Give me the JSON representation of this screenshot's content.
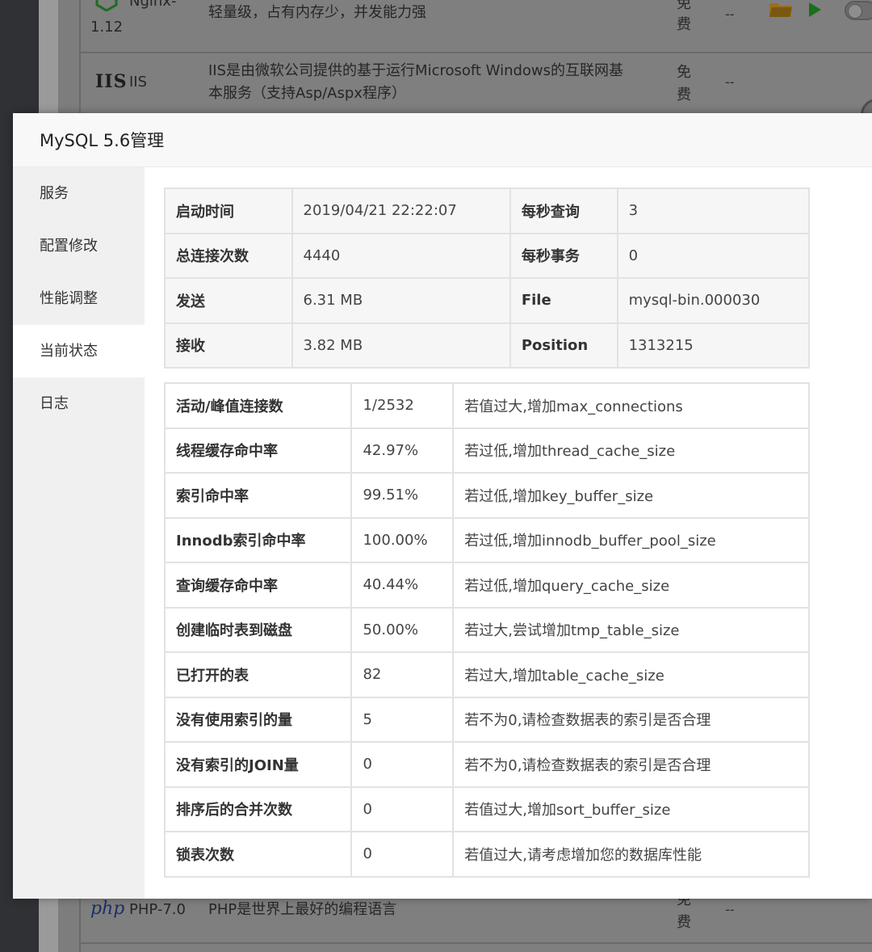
{
  "background": {
    "nginx": {
      "name_fragment": "Nginx-",
      "version": "1.12",
      "desc": "轻量级，占有内存少，并发能力强",
      "fee": "免费",
      "extra": "--"
    },
    "iis": {
      "logo": "IIS",
      "name": "IIS",
      "desc_line1": "IIS是由微软公司提供的基于运行Microsoft Windows的互联网基",
      "desc_line2": "本服务（支持Asp/Aspx程序）",
      "fee": "免费",
      "extra": "--"
    },
    "php": {
      "logo": "php",
      "name": "PHP-7.0",
      "desc": "PHP是世界上最好的编程语言",
      "fee": "免费",
      "extra": "--"
    }
  },
  "modal": {
    "title": "MySQL 5.6管理",
    "nav": [
      {
        "label": "服务",
        "active": false
      },
      {
        "label": "配置修改",
        "active": false
      },
      {
        "label": "性能调整",
        "active": false
      },
      {
        "label": "当前状态",
        "active": true
      },
      {
        "label": "日志",
        "active": false
      }
    ],
    "status_table": [
      [
        "启动时间",
        "2019/04/21 22:22:07",
        "每秒查询",
        "3"
      ],
      [
        "总连接次数",
        "4440",
        "每秒事务",
        "0"
      ],
      [
        "发送",
        "6.31 MB",
        "File",
        "mysql-bin.000030"
      ],
      [
        "接收",
        "3.82 MB",
        "Position",
        "1313215"
      ]
    ],
    "perf_table": [
      [
        "活动/峰值连接数",
        "1/2532",
        "若值过大,增加max_connections"
      ],
      [
        "线程缓存命中率",
        "42.97%",
        "若过低,增加thread_cache_size"
      ],
      [
        "索引命中率",
        "99.51%",
        "若过低,增加key_buffer_size"
      ],
      [
        "Innodb索引命中率",
        "100.00%",
        "若过低,增加innodb_buffer_pool_size"
      ],
      [
        "查询缓存命中率",
        "40.44%",
        "若过低,增加query_cache_size"
      ],
      [
        "创建临时表到磁盘",
        "50.00%",
        "若过大,尝试增加tmp_table_size"
      ],
      [
        "已打开的表",
        "82",
        "若过大,增加table_cache_size"
      ],
      [
        "没有使用索引的量",
        "5",
        "若不为0,请检查数据表的索引是否合理"
      ],
      [
        "没有索引的JOIN量",
        "0",
        "若不为0,请检查数据表的索引是否合理"
      ],
      [
        "排序后的合并次数",
        "0",
        "若值过大,增加sort_buffer_size"
      ],
      [
        "锁表次数",
        "0",
        "若值过大,请考虑增加您的数据库性能"
      ]
    ]
  },
  "colors": {
    "overlay": "#5c5c5c",
    "modal_bg": "#ffffff",
    "sidebar_bg": "#f0f0f0",
    "table_border": "#e2e2e2"
  }
}
